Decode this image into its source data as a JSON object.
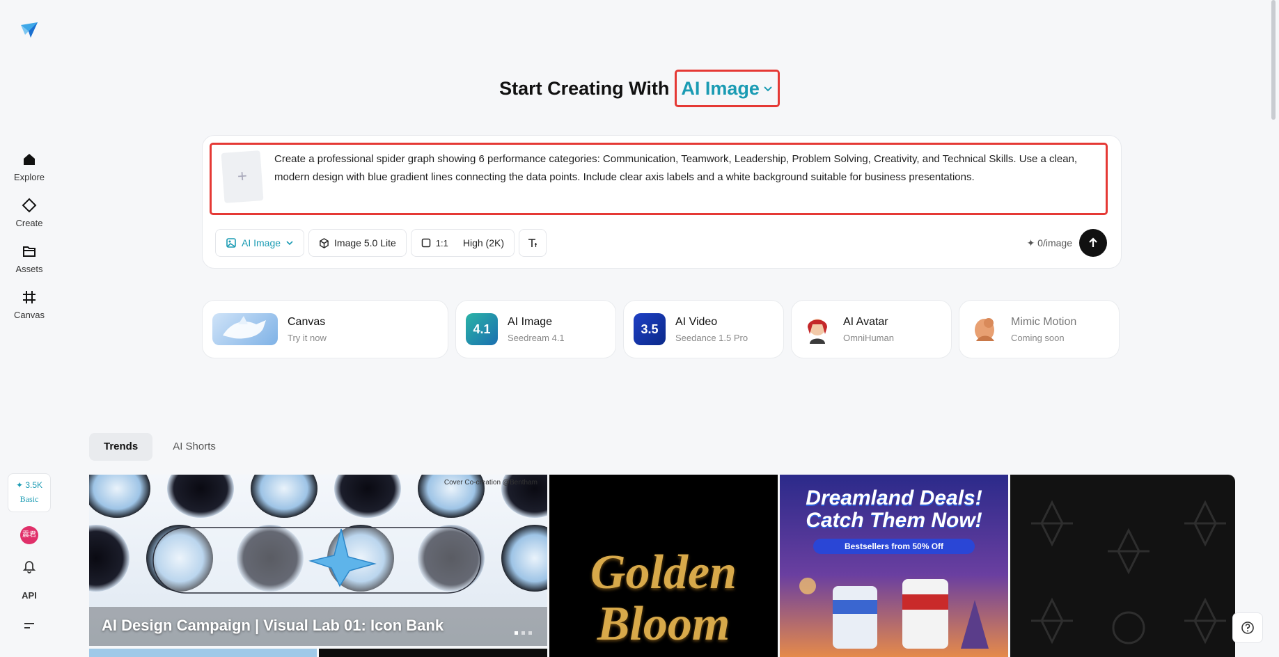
{
  "sidebar": {
    "items": [
      {
        "label": "Explore",
        "icon": "home-icon"
      },
      {
        "label": "Create",
        "icon": "diamond-icon"
      },
      {
        "label": "Assets",
        "icon": "folder-icon"
      },
      {
        "label": "Canvas",
        "icon": "canvas-icon"
      }
    ],
    "credits": {
      "amount": "✦ 3.5K",
      "tier": "Basic"
    },
    "avatar_text": "震君",
    "api_label": "API"
  },
  "heading": {
    "static": "Start Creating With",
    "mode": "AI Image"
  },
  "prompt": {
    "text": "Create a professional spider graph showing 6 performance categories: Communication, Teamwork, Leadership, Problem Solving, Creativity, and Technical Skills. Use a clean, modern design with blue gradient lines connecting the data points. Include clear axis labels and a white background suitable for business presentations.",
    "upload_symbol": "+"
  },
  "toolbar": {
    "mode": "AI Image",
    "model": "Image 5.0 Lite",
    "ratio": "1:1",
    "quality": "High (2K)",
    "cost": "✦ 0/image"
  },
  "features": [
    {
      "title": "Canvas",
      "sub": "Try it now",
      "badge": ""
    },
    {
      "title": "AI Image",
      "sub": "Seedream 4.1",
      "badge": "4.1"
    },
    {
      "title": "AI Video",
      "sub": "Seedance 1.5 Pro",
      "badge": "3.5"
    },
    {
      "title": "AI Avatar",
      "sub": "OmniHuman",
      "badge": ""
    },
    {
      "title": "Mimic Motion",
      "sub": "Coming soon",
      "badge": ""
    }
  ],
  "tabs": [
    {
      "label": "Trends"
    },
    {
      "label": "AI Shorts"
    }
  ],
  "gallery": {
    "card1_title": "AI Design Campaign | Visual Lab 01: Icon Bank",
    "card1_credit": "Cover Co-creation @Bentham",
    "card2_text": "Golden Bloom",
    "card3_title": "Dreamland Deals! Catch Them Now!",
    "card3_sub": "Bestsellers from 50% Off"
  },
  "colors": {
    "accent": "#1a9bb3",
    "highlight": "#e53935",
    "background": "#f6f7f9"
  }
}
